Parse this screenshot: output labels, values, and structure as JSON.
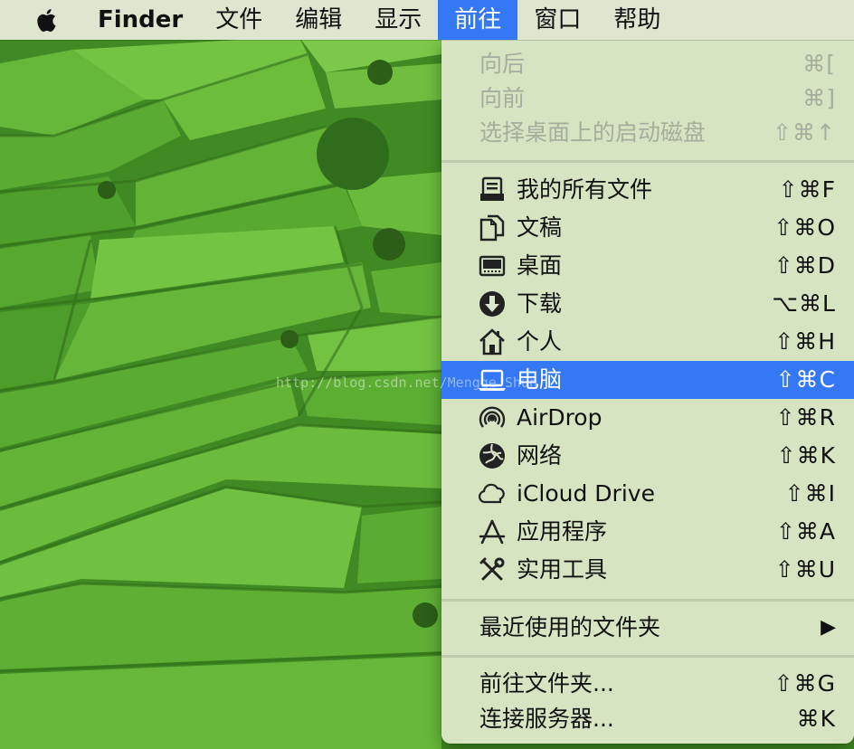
{
  "menubar": {
    "apple_icon": "apple-logo-icon",
    "app_name": "Finder",
    "items": [
      "文件",
      "编辑",
      "显示",
      "前往",
      "窗口",
      "帮助"
    ],
    "active_item": "前往"
  },
  "menu": {
    "history": [
      {
        "label": "向后",
        "shortcut": "⌘[",
        "enabled": false
      },
      {
        "label": "向前",
        "shortcut": "⌘]",
        "enabled": false
      },
      {
        "label": "选择桌面上的启动磁盘",
        "shortcut": "⇧⌘↑",
        "enabled": false
      }
    ],
    "places": [
      {
        "label": "我的所有文件",
        "shortcut": "⇧⌘F",
        "icon": "all-files-icon"
      },
      {
        "label": "文稿",
        "shortcut": "⇧⌘O",
        "icon": "documents-icon"
      },
      {
        "label": "桌面",
        "shortcut": "⇧⌘D",
        "icon": "desktop-icon"
      },
      {
        "label": "下载",
        "shortcut": "⌥⌘L",
        "icon": "downloads-icon"
      },
      {
        "label": "个人",
        "shortcut": "⇧⌘H",
        "icon": "home-icon"
      },
      {
        "label": "电脑",
        "shortcut": "⇧⌘C",
        "icon": "computer-icon",
        "selected": true
      },
      {
        "label": "AirDrop",
        "shortcut": "⇧⌘R",
        "icon": "airdrop-icon"
      },
      {
        "label": "网络",
        "shortcut": "⇧⌘K",
        "icon": "network-icon"
      },
      {
        "label": "iCloud Drive",
        "shortcut": "⇧⌘I",
        "icon": "icloud-icon"
      },
      {
        "label": "应用程序",
        "shortcut": "⇧⌘A",
        "icon": "applications-icon"
      },
      {
        "label": "实用工具",
        "shortcut": "⇧⌘U",
        "icon": "utilities-icon"
      }
    ],
    "recent": {
      "label": "最近使用的文件夹",
      "submenu_icon": "triangle-right-icon"
    },
    "goto_folder": {
      "label": "前往文件夹...",
      "shortcut": "⇧⌘G"
    },
    "connect_server": {
      "label": "连接服务器...",
      "shortcut": "⌘K"
    }
  },
  "watermark": "http://blog.csdn.net/Mengge_Shun"
}
